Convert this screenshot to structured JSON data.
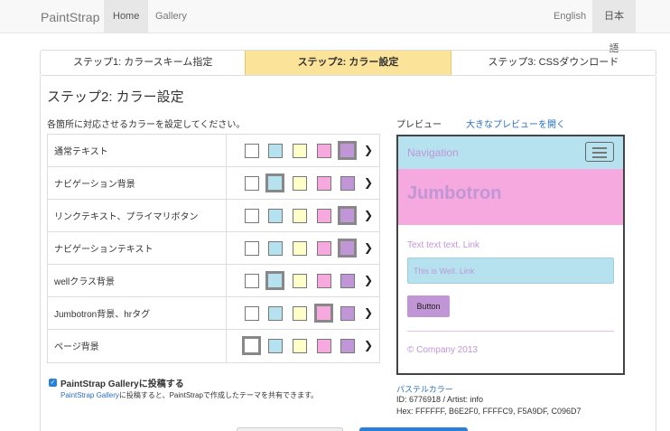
{
  "navbar": {
    "brand": "PaintStrap",
    "home": "Home",
    "gallery": "Gallery",
    "english": "English",
    "japanese": "日本語"
  },
  "steps": [
    {
      "label": "ステップ1: カラースキーム指定"
    },
    {
      "label": "ステップ2: カラー設定"
    },
    {
      "label": "ステップ3: CSSダウンロード"
    }
  ],
  "heading": "ステップ2: カラー設定",
  "instruction": "各箇所に対応させるカラーを設定してください。",
  "palette": [
    "#FFFFFF",
    "#B6E2F0",
    "#FFFFC9",
    "#F5A9DF",
    "#C096D7"
  ],
  "rows": [
    {
      "label": "通常テキスト",
      "selected": 4
    },
    {
      "label": "ナビゲーション背景",
      "selected": 1
    },
    {
      "label": "リンクテキスト、プライマリボタン",
      "selected": 4
    },
    {
      "label": "ナビゲーションテキスト",
      "selected": 4
    },
    {
      "label": "wellクラス背景",
      "selected": 1
    },
    {
      "label": "Jumbotron背景、hrタグ",
      "selected": 3
    },
    {
      "label": "ページ背景",
      "selected": 0
    }
  ],
  "arrow_icon": "chevron-right-icon",
  "gallery_post": {
    "checked": true,
    "label": "PaintStrap Galleryに投稿する",
    "help_link": "PaintStrap Gallery",
    "help_text": "に投稿すると、PaintStrapで作成したテーマを共有できます。"
  },
  "preview": {
    "label": "プレビュー",
    "open_large": "大きなプレビューを開く",
    "nav_brand": "Navigation",
    "jumbotron": "Jumbotron",
    "text": "Text text text. Link",
    "well": "This is Well. Link",
    "button": "Button",
    "footer": "© Company 2013"
  },
  "scheme": {
    "name": "パステルカラー",
    "id_line": "ID: 6776918 / Artist: info",
    "hex_line": "Hex: FFFFFF, B6E2F0, FFFFC9, F5A9DF, C096D7"
  }
}
